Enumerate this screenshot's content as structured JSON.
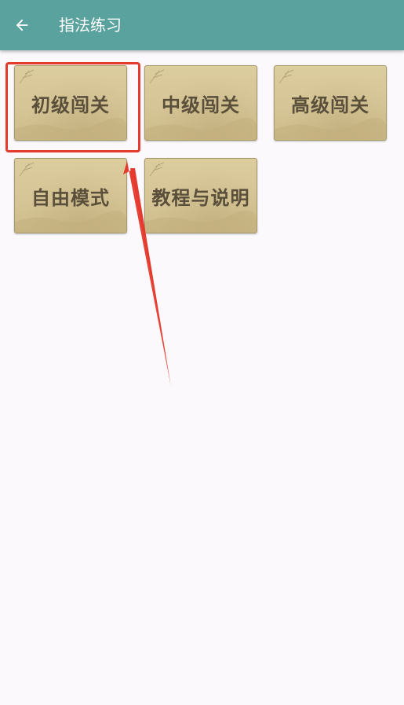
{
  "appbar": {
    "title": "指法练习",
    "back_icon": "arrow-left-icon",
    "color": "#5aa29e"
  },
  "tiles": [
    {
      "label": "初级闯关"
    },
    {
      "label": "中级闯关"
    },
    {
      "label": "高级闯关"
    },
    {
      "label": "自由模式"
    },
    {
      "label": "教程与说明"
    }
  ],
  "annotation": {
    "highlight_color": "#e53b2f"
  }
}
